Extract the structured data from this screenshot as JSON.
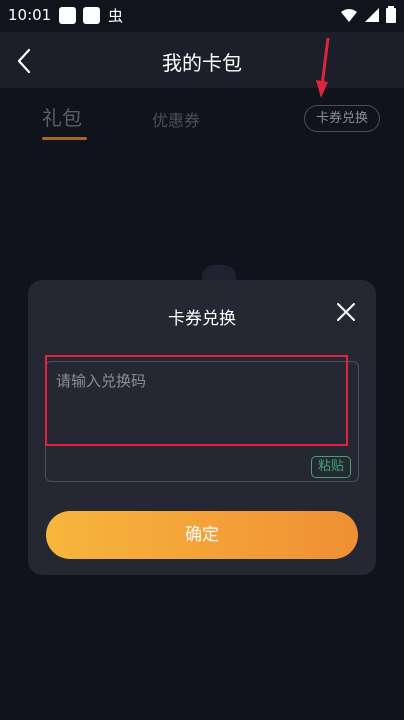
{
  "status_bar": {
    "time": "10:01",
    "extra_icon_label": "虫"
  },
  "nav": {
    "title": "我的卡包"
  },
  "tabs": [
    {
      "label": "礼包",
      "active": true
    },
    {
      "label": "优惠券",
      "active": false
    }
  ],
  "redeem_button": {
    "label": "卡券兑换"
  },
  "dialog": {
    "title": "卡券兑换",
    "input_placeholder": "请输入兑换码",
    "input_value": "",
    "paste_label": "粘贴",
    "confirm_label": "确定"
  },
  "colors": {
    "background": "#11131c",
    "dialog_bg": "#252833",
    "accent_gradient_start": "#f7b63d",
    "accent_gradient_end": "#f08f34",
    "paste_green": "#3ea56d",
    "annotation_red": "#e0243a"
  },
  "icons": [
    "back-arrow-icon",
    "close-icon",
    "wifi-icon",
    "signal-icon",
    "battery-icon",
    "annotation-arrow-icon"
  ]
}
